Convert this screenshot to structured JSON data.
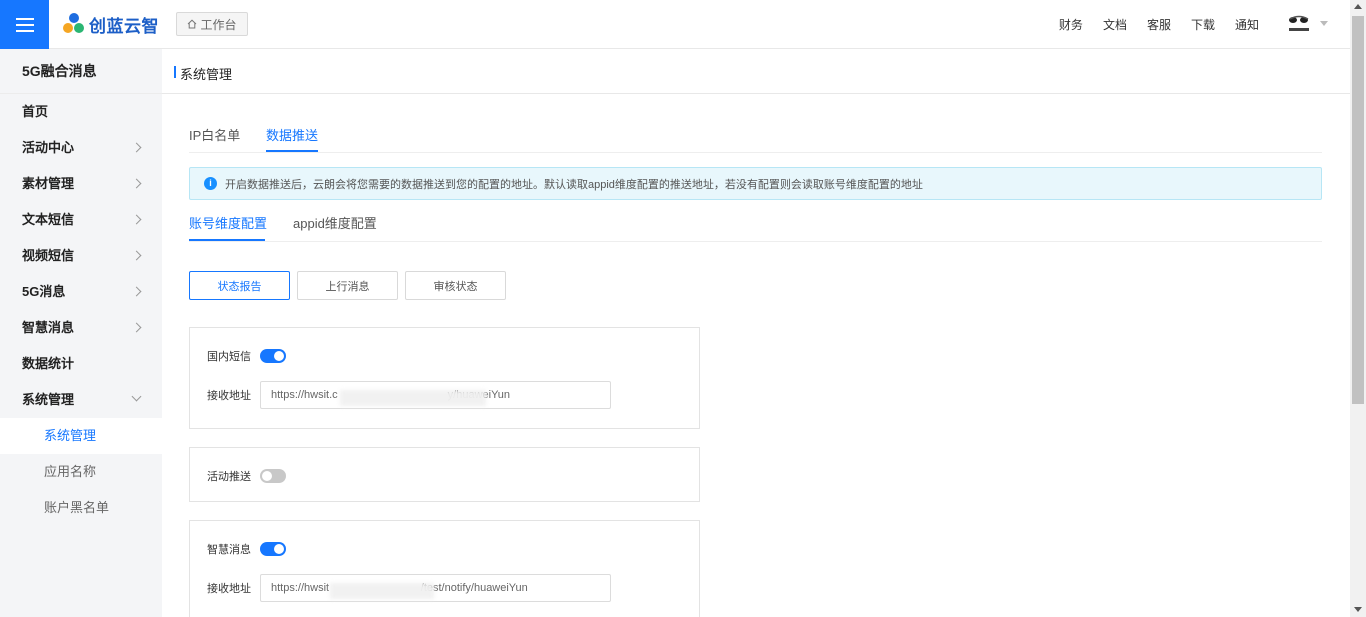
{
  "header": {
    "logo_text": "创蓝云智",
    "workbench_label": "工作台",
    "links": [
      "财务",
      "文档",
      "客服",
      "下载",
      "通知"
    ]
  },
  "sidebar": {
    "title": "5G融合消息",
    "items": [
      {
        "label": "首页",
        "expandable": false
      },
      {
        "label": "活动中心",
        "expandable": true
      },
      {
        "label": "素材管理",
        "expandable": true
      },
      {
        "label": "文本短信",
        "expandable": true
      },
      {
        "label": "视频短信",
        "expandable": true
      },
      {
        "label": "5G消息",
        "expandable": true
      },
      {
        "label": "智慧消息",
        "expandable": true
      },
      {
        "label": "数据统计",
        "expandable": false
      },
      {
        "label": "系统管理",
        "expandable": true,
        "expanded": true
      }
    ],
    "sub_items": [
      {
        "label": "系统管理",
        "active": true
      },
      {
        "label": "应用名称",
        "active": false
      },
      {
        "label": "账户黑名单",
        "active": false
      }
    ]
  },
  "page": {
    "title": "系统管理",
    "tabs": [
      {
        "label": "IP白名单",
        "active": false
      },
      {
        "label": "数据推送",
        "active": true
      }
    ],
    "notice": "开启数据推送后，云朗会将您需要的数据推送到您的配置的地址。默认读取appid维度配置的推送地址，若没有配置则会读取账号维度配置的地址",
    "subtabs": [
      {
        "label": "账号维度配置",
        "active": true
      },
      {
        "label": "appid维度配置",
        "active": false
      }
    ],
    "buttons": [
      {
        "label": "状态报告",
        "active": true
      },
      {
        "label": "上行消息",
        "active": false
      },
      {
        "label": "审核状态",
        "active": false
      }
    ],
    "cards": [
      {
        "label": "国内短信",
        "enabled": true,
        "url_label": "接收地址",
        "url": "https://hwsit.c                                    y/huaweiYun"
      },
      {
        "label": "活动推送",
        "enabled": false
      },
      {
        "label": "智慧消息",
        "enabled": true,
        "url_label": "接收地址",
        "url": "https://hwsit                              /test/notify/huaweiYun"
      }
    ]
  },
  "colors": {
    "primary": "#1677ff",
    "sidebar_bg": "#f4f5f7",
    "notice_bg": "#e8f7fc"
  },
  "icons": {
    "menu": "hamburger-icon",
    "home": "home-icon",
    "info": "info-icon",
    "chevron": "chevron-right-icon"
  }
}
